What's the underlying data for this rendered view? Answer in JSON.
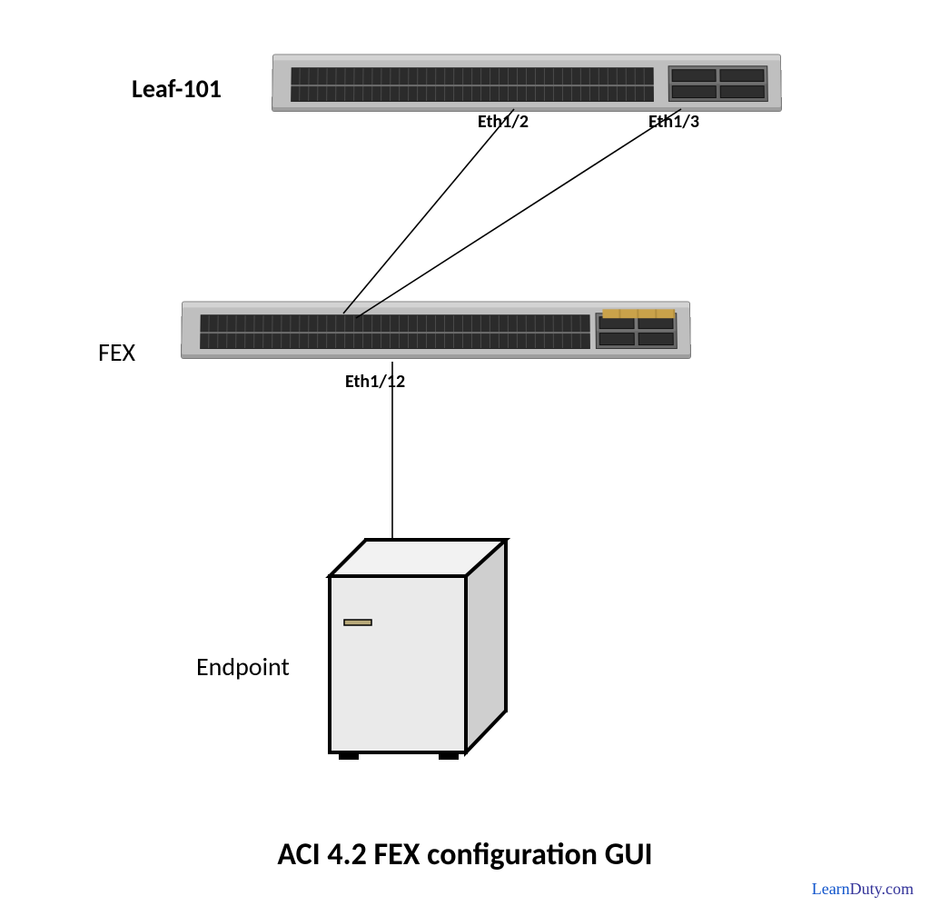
{
  "nodes": {
    "leaf": {
      "label": "Leaf-101",
      "ports": {
        "eth12": "Eth1/2",
        "eth13": "Eth1/3"
      }
    },
    "fex": {
      "label": "FEX",
      "ports": {
        "eth112": "Eth1/12"
      }
    },
    "endpoint": {
      "label": "Endpoint"
    }
  },
  "title": "ACI 4.2 FEX configuration GUI",
  "credit": {
    "part_a": "Learn",
    "part_b": "Duty.com"
  },
  "connections": [
    {
      "from": "leaf.Eth1/2",
      "to": "fex.uplink"
    },
    {
      "from": "leaf.Eth1/3",
      "to": "fex.uplink"
    },
    {
      "from": "fex.Eth1/12",
      "to": "endpoint"
    }
  ]
}
